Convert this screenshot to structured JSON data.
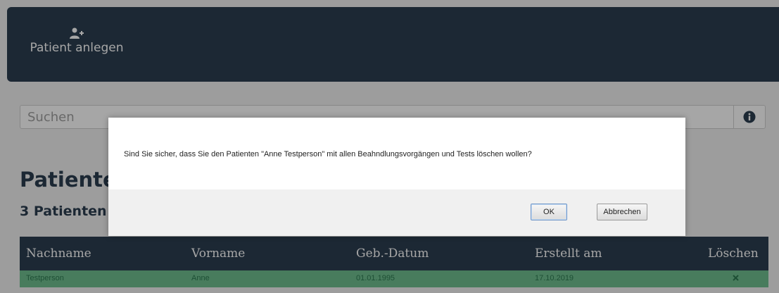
{
  "nav": {
    "add_patient_label": "Patient anlegen"
  },
  "search": {
    "placeholder": "Suchen"
  },
  "page": {
    "heading": "Patienten",
    "count": "3 Patienten"
  },
  "table": {
    "headers": [
      "Nachname",
      "Vorname",
      "Geb.-Datum",
      "Erstellt am",
      "Löschen"
    ],
    "rows": [
      {
        "nachname": "Testperson",
        "vorname": "Anne",
        "geburtsdatum": "01.01.1995",
        "erstellt": "17.10.2019"
      }
    ]
  },
  "dialog": {
    "message": "Sind Sie sicher, dass Sie den Patienten \"Anne Testperson\" mit allen Beahndlungsvorgängen und Tests löschen wollen?",
    "ok_label": "OK",
    "cancel_label": "Abbrechen"
  },
  "colors": {
    "nav_bg": "#2c3e50",
    "row_highlight": "#6fbf8f"
  },
  "icons": {
    "add_patient": "add-user-icon",
    "info": "info-icon",
    "delete": "delete-icon"
  }
}
